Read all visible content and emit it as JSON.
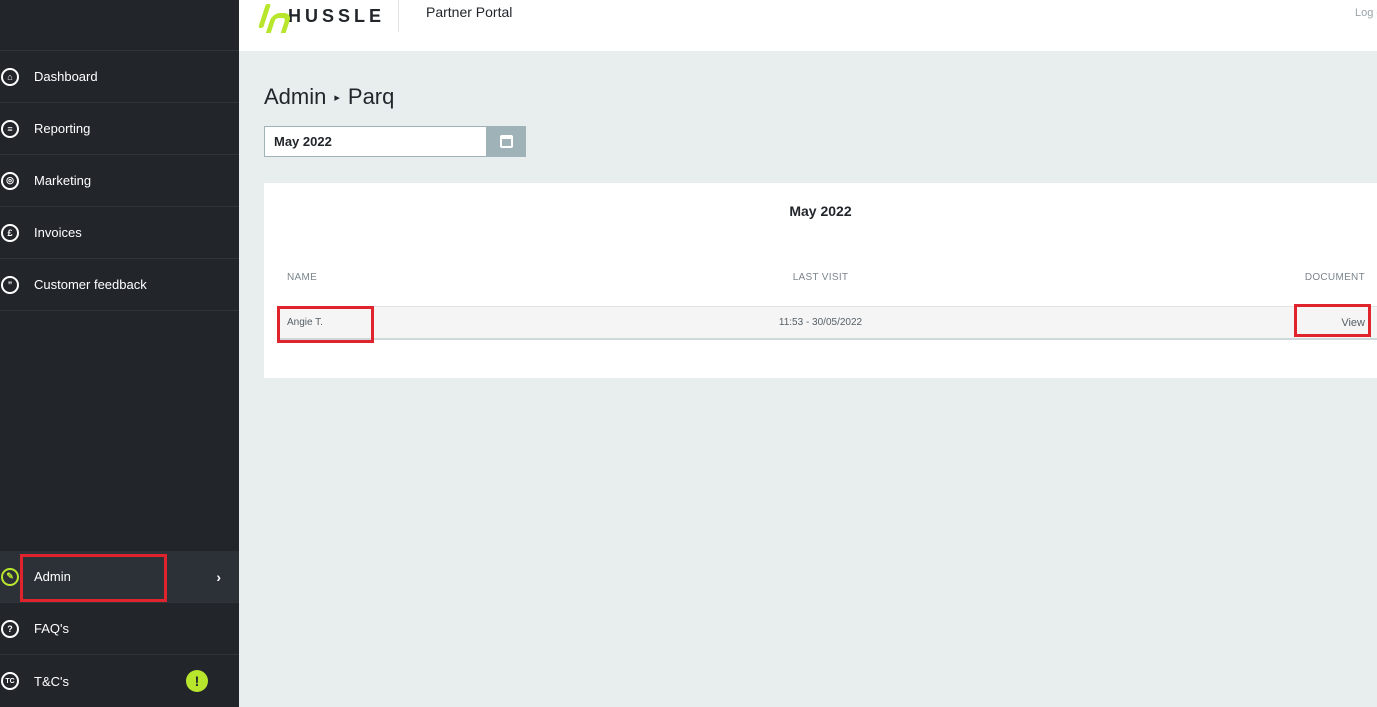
{
  "header": {
    "brand": "HUSSLE",
    "portal_title": "Partner Portal",
    "logout_label": "Log o"
  },
  "sidebar": {
    "items": [
      {
        "label": "Dashboard",
        "icon": "home-icon"
      },
      {
        "label": "Reporting",
        "icon": "report-icon"
      },
      {
        "label": "Marketing",
        "icon": "target-icon"
      },
      {
        "label": "Invoices",
        "icon": "pound-icon"
      },
      {
        "label": "Customer feedback",
        "icon": "quote-icon"
      }
    ],
    "bottom_items": [
      {
        "label": "Admin",
        "icon": "admin-icon",
        "active": true
      },
      {
        "label": "FAQ's",
        "icon": "question-icon"
      },
      {
        "label": "T&C's",
        "icon": "tc-icon",
        "badge": "!"
      }
    ]
  },
  "breadcrumb": {
    "parent": "Admin",
    "separator": "▸",
    "current": "Parq"
  },
  "date_picker": {
    "value": "May 2022"
  },
  "table": {
    "title": "May 2022",
    "columns": [
      "NAME",
      "LAST VISIT",
      "DOCUMENT"
    ],
    "rows": [
      {
        "name": "Angie T.",
        "last_visit": "11:53 - 30/05/2022",
        "document": "View"
      }
    ]
  },
  "colors": {
    "sidebar_bg": "#22262b",
    "accent": "#b8e62d",
    "highlight_box": "#e0242d"
  }
}
